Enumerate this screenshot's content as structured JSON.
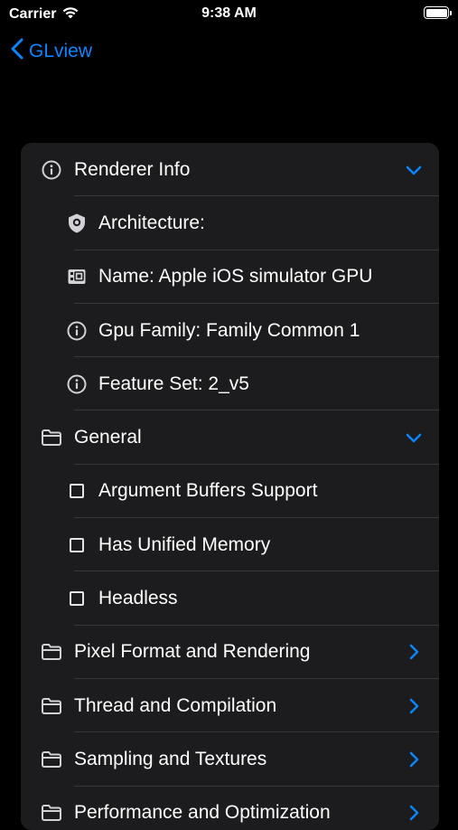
{
  "status_bar": {
    "carrier": "Carrier",
    "time": "9:38 AM"
  },
  "nav": {
    "back_label": "GLview"
  },
  "colors": {
    "accent": "#0a84ff",
    "row_bg": "#1c1c1e",
    "separator": "#38383a"
  },
  "rows": [
    {
      "kind": "section",
      "icon": "info-icon",
      "label": "Renderer Info",
      "chevron": "down"
    },
    {
      "kind": "child",
      "icon": "shield-icon",
      "label": "Architecture:"
    },
    {
      "kind": "child",
      "icon": "chip-icon",
      "label": "Name: Apple iOS simulator GPU"
    },
    {
      "kind": "child",
      "icon": "info-icon",
      "label": "Gpu Family: Family Common 1"
    },
    {
      "kind": "child",
      "icon": "info-icon",
      "label": "Feature Set: 2_v5"
    },
    {
      "kind": "section",
      "icon": "folder-icon",
      "label": "General",
      "chevron": "down"
    },
    {
      "kind": "child",
      "icon": "checkbox-icon",
      "label": "Argument Buffers Support"
    },
    {
      "kind": "child",
      "icon": "checkbox-icon",
      "label": "Has Unified Memory"
    },
    {
      "kind": "child",
      "icon": "checkbox-icon",
      "label": "Headless"
    },
    {
      "kind": "section",
      "icon": "folder-icon",
      "label": "Pixel Format and Rendering",
      "chevron": "right"
    },
    {
      "kind": "section",
      "icon": "folder-icon",
      "label": "Thread and Compilation",
      "chevron": "right"
    },
    {
      "kind": "section",
      "icon": "folder-icon",
      "label": "Sampling and Textures",
      "chevron": "right"
    },
    {
      "kind": "section",
      "icon": "folder-icon",
      "label": "Performance and Optimization",
      "chevron": "right"
    }
  ]
}
